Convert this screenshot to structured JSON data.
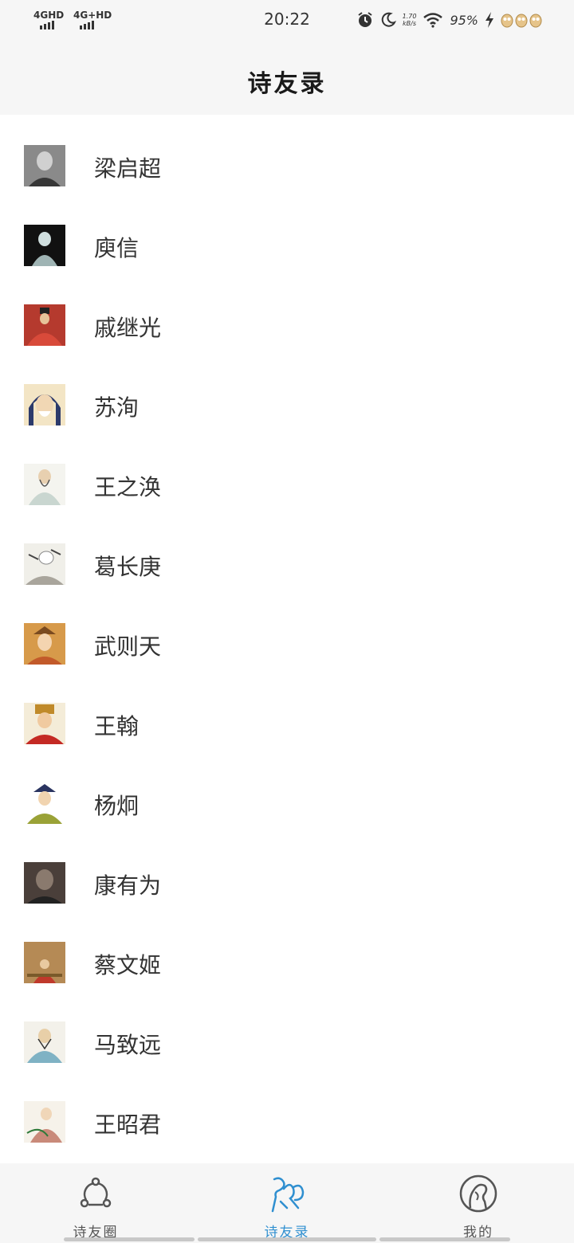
{
  "status_bar": {
    "sim1": "4GHD",
    "sim2": "4G+HD",
    "time": "20:22",
    "speed_value": "1.70",
    "speed_unit": "kB/s",
    "battery": "95%"
  },
  "header": {
    "title": "诗友录"
  },
  "poets": [
    {
      "name": "梁启超",
      "avatar_color": "#8a8a8a"
    },
    {
      "name": "庾信",
      "avatar_color": "#9fb4b4"
    },
    {
      "name": "戚继光",
      "avatar_color": "#b53a2e"
    },
    {
      "name": "苏洵",
      "avatar_color": "#2c3a6b"
    },
    {
      "name": "王之涣",
      "avatar_color": "#c9d6d0"
    },
    {
      "name": "葛长庚",
      "avatar_color": "#a9a59c"
    },
    {
      "name": "武则天",
      "avatar_color": "#d79a4a"
    },
    {
      "name": "王翰",
      "avatar_color": "#c42a24"
    },
    {
      "name": "杨炯",
      "avatar_color": "#9aa237"
    },
    {
      "name": "康有为",
      "avatar_color": "#4a3f3a"
    },
    {
      "name": "蔡文姬",
      "avatar_color": "#b58a55"
    },
    {
      "name": "马致远",
      "avatar_color": "#7fb2c4"
    },
    {
      "name": "王昭君",
      "avatar_color": "#c98a7a"
    }
  ],
  "tabs": [
    {
      "label": "诗友圈",
      "icon": "circle-nodes-icon",
      "active": false
    },
    {
      "label": "诗友录",
      "icon": "calligraphy-icon",
      "active": true
    },
    {
      "label": "我的",
      "icon": "profile-icon",
      "active": false
    }
  ],
  "colors": {
    "accent": "#2f8fd0",
    "background": "#f6f6f6"
  }
}
